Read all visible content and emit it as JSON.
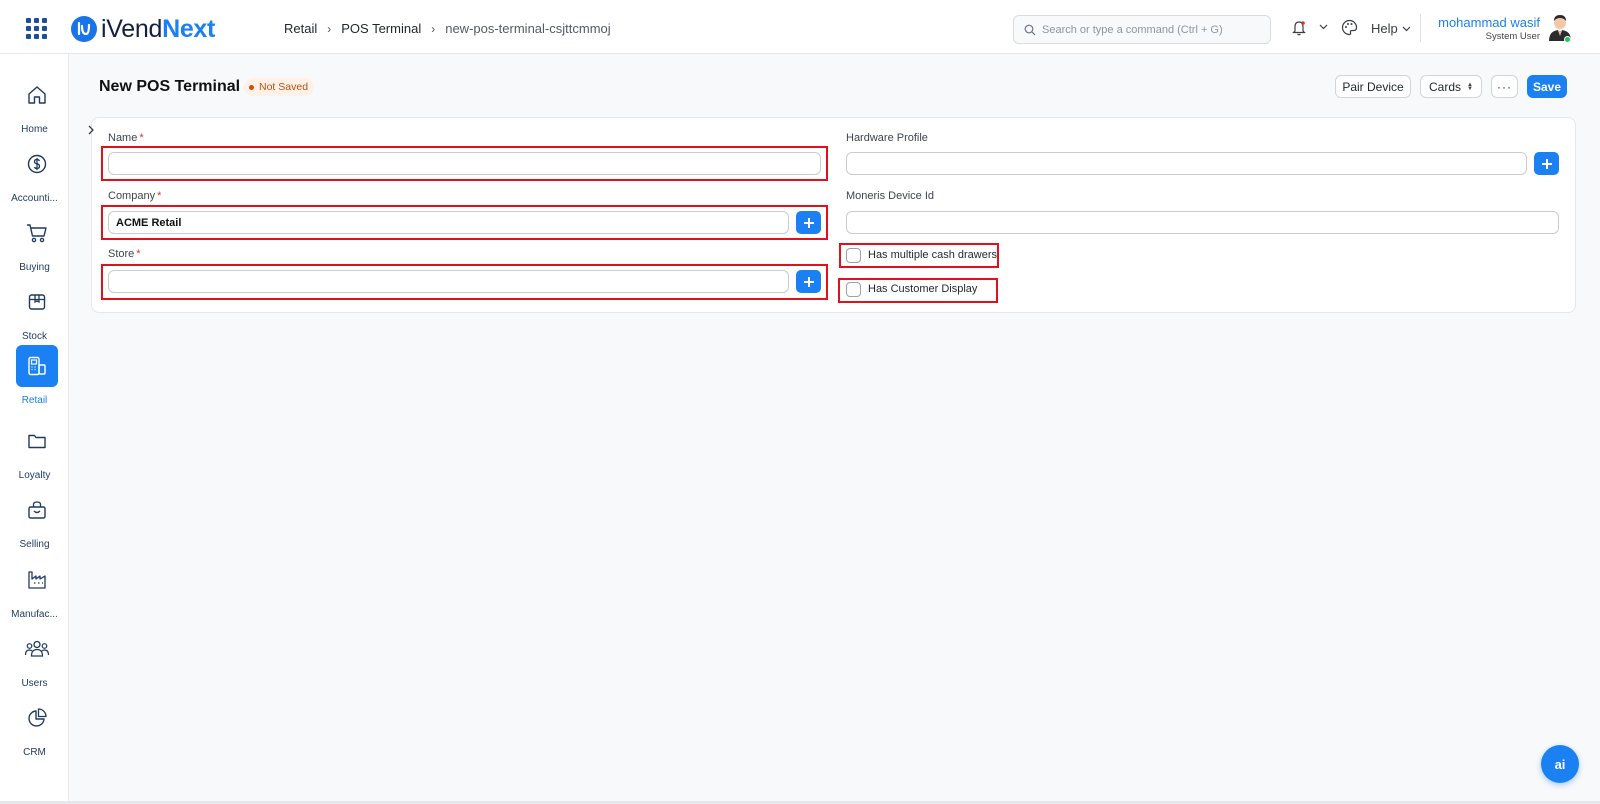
{
  "app": {
    "logo_a": "iVend",
    "logo_b": "Next"
  },
  "breadcrumb": [
    "Retail",
    "POS Terminal",
    "new-pos-terminal-csjttcmmoj"
  ],
  "search": {
    "placeholder": "Search or type a command (Ctrl + G)"
  },
  "header": {
    "help_label": "Help"
  },
  "user": {
    "name": "mohammad wasif",
    "role": "System User"
  },
  "sidebar": {
    "items": [
      {
        "label": "Home",
        "icon": "home-icon"
      },
      {
        "label": "Accounti...",
        "icon": "dollar-icon"
      },
      {
        "label": "Buying",
        "icon": "cart-icon"
      },
      {
        "label": "Stock",
        "icon": "box-icon"
      },
      {
        "label": "Retail",
        "icon": "pos-terminal-icon",
        "active": true
      },
      {
        "label": "Loyalty",
        "icon": "folder-icon"
      },
      {
        "label": "Selling",
        "icon": "shopping-bag-icon"
      },
      {
        "label": "Manufac...",
        "icon": "factory-icon"
      },
      {
        "label": "Users",
        "icon": "users-icon"
      },
      {
        "label": "CRM",
        "icon": "pie-chart-icon"
      }
    ]
  },
  "page": {
    "title": "New POS Terminal",
    "status": "Not Saved",
    "buttons": {
      "pair_device": "Pair Device",
      "cards": "Cards",
      "more": "···",
      "save": "Save"
    }
  },
  "form": {
    "name": {
      "label": "Name",
      "required": "*",
      "value": ""
    },
    "company": {
      "label": "Company",
      "required": "*",
      "value": "ACME Retail"
    },
    "store": {
      "label": "Store",
      "required": "*",
      "value": ""
    },
    "hardware_profile": {
      "label": "Hardware Profile",
      "value": ""
    },
    "moneris_device_id": {
      "label": "Moneris Device Id",
      "value": ""
    },
    "has_multiple_cash_drawers": {
      "label": "Has multiple cash drawers",
      "checked": false
    },
    "has_customer_display": {
      "label": "Has Customer Display",
      "checked": false
    }
  },
  "ai_button": {
    "label": "ai"
  },
  "colors": {
    "accent": "#1b80f2",
    "highlight": "#e0101d",
    "not_saved": "#b25114"
  }
}
